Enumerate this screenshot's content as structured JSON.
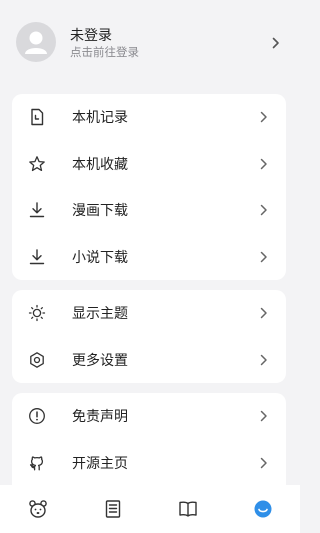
{
  "profile": {
    "name": "未登录",
    "subtitle": "点击前往登录"
  },
  "groups": [
    {
      "items": [
        {
          "label": "本机记录",
          "icon": "history-doc-icon"
        },
        {
          "label": "本机收藏",
          "icon": "star-icon"
        },
        {
          "label": "漫画下载",
          "icon": "download-icon"
        },
        {
          "label": "小说下载",
          "icon": "download-icon"
        }
      ]
    },
    {
      "items": [
        {
          "label": "显示主题",
          "icon": "sun-theme-icon"
        },
        {
          "label": "更多设置",
          "icon": "settings-hexagon-icon"
        }
      ]
    },
    {
      "items": [
        {
          "label": "免责声明",
          "icon": "alert-circle-icon"
        },
        {
          "label": "开源主页",
          "icon": "github-icon"
        }
      ]
    }
  ],
  "tabs": [
    {
      "icon": "bear-icon",
      "active": false
    },
    {
      "icon": "list-doc-icon",
      "active": false
    },
    {
      "icon": "book-icon",
      "active": false
    },
    {
      "icon": "profile-smile-icon",
      "active": true
    }
  ],
  "colors": {
    "accent": "#2f8fe8",
    "text": "#222222",
    "subtext": "#8a8a8f",
    "background": "#f3f3f5"
  }
}
